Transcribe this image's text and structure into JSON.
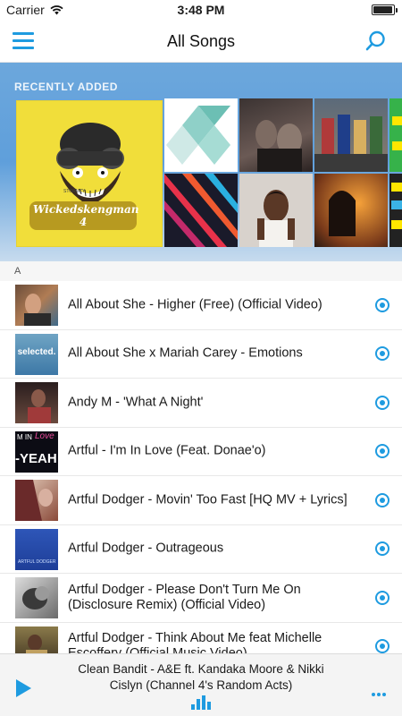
{
  "status_bar": {
    "carrier": "Carrier",
    "time": "3:48 PM",
    "wifi_icon": "wifi-icon",
    "battery_icon": "battery-icon"
  },
  "nav": {
    "title": "All Songs",
    "menu_icon": "hamburger-menu-icon",
    "search_icon": "search-icon"
  },
  "recently_added": {
    "title": "RECENTLY ADDED",
    "featured": {
      "art_text": "Wickedskengman 4",
      "label_text": "STORMZY"
    }
  },
  "section_letter": "A",
  "songs": [
    {
      "title": "All About She - Higher (Free) (Official Video)"
    },
    {
      "title": "All About She x Mariah Carey - Emotions",
      "thumb_text": "selected."
    },
    {
      "title": "Andy M - 'What A Night'"
    },
    {
      "title": "Artful - I'm In Love (Feat. Donae'o)",
      "thumb_text_1": "M IN",
      "thumb_text_2": "Love",
      "thumb_text_3": "-YEAH"
    },
    {
      "title": "Artful Dodger - Movin' Too Fast [HQ MV + Lyrics]"
    },
    {
      "title": "Artful Dodger - Outrageous",
      "thumb_text": "ARTFUL DODGER"
    },
    {
      "title": "Artful Dodger - Please Don't Turn Me On (Disclosure Remix) (Official Video)"
    },
    {
      "title": "Artful Dodger - Think About Me feat Michelle Escoffery (Official Music Video)"
    }
  ],
  "player": {
    "now_playing": "Clean Bandit - A&E ft. Kandaka Moore & Nikki Cislyn (Channel 4's Random Acts)",
    "play_icon": "play-icon",
    "more_icon": "more-icon",
    "equalizer_icon": "equalizer-icon"
  },
  "colors": {
    "accent": "#1e9be0",
    "header_gradient_top": "#6ca7dc",
    "featured_yellow": "#f1de3a"
  }
}
